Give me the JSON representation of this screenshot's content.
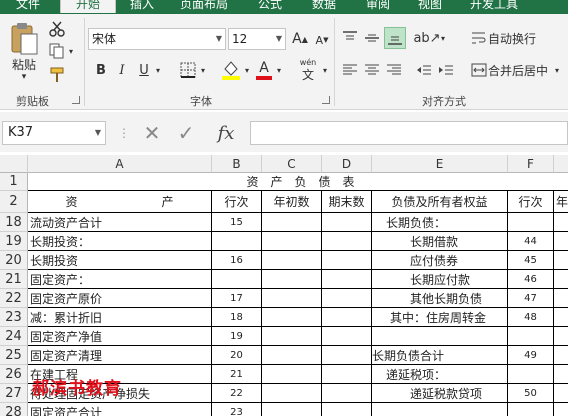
{
  "tabs": [
    "文件",
    "开始",
    "插入",
    "页面布局",
    "公式",
    "数据",
    "审阅",
    "视图",
    "开发工具"
  ],
  "clipboard": {
    "paste": "粘贴",
    "group": "剪贴板"
  },
  "font": {
    "name": "宋体",
    "size": "12",
    "bold": "B",
    "italic": "I",
    "underline": "U",
    "group": "字体",
    "phonetic": "wén"
  },
  "alignment": {
    "wrap": "自动换行",
    "merge": "合并后居中",
    "group": "对齐方式"
  },
  "formula_bar": {
    "name_box": "K37",
    "fx": "fx",
    "value": ""
  },
  "columns": [
    "A",
    "B",
    "C",
    "D",
    "E",
    "F"
  ],
  "sheet": {
    "title": "资　产　负　债　表",
    "header": {
      "asset": "资　　　　　　　产",
      "row_no": "行次",
      "begin": "年初数",
      "end": "期末数",
      "liab": "负债及所有者权益",
      "row_no2": "行次",
      "partial": "年"
    },
    "rows": [
      {
        "n": "18",
        "a": "流动资产合计",
        "b": "15",
        "e": "长期负债：",
        "f": ""
      },
      {
        "n": "19",
        "a": "长期投资：",
        "b": "",
        "e": "长期借款",
        "f": "44"
      },
      {
        "n": "20",
        "a": "长期投资",
        "b": "16",
        "e": "应付债券",
        "f": "45"
      },
      {
        "n": "21",
        "a": "固定资产：",
        "b": "",
        "e": "长期应付款",
        "f": "46"
      },
      {
        "n": "22",
        "a": "固定资产原价",
        "b": "17",
        "e": "其他长期负债",
        "f": "47"
      },
      {
        "n": "23",
        "a": "减：累计折旧",
        "b": "18",
        "e": "其中：住房周转金",
        "f": "48"
      },
      {
        "n": "24",
        "a": "固定资产净值",
        "b": "19",
        "e": "",
        "f": ""
      },
      {
        "n": "25",
        "a": "固定资产清理",
        "b": "20",
        "e": "长期负债合计",
        "f": "49"
      },
      {
        "n": "26",
        "a": "在建工程",
        "b": "21",
        "e": "递延税项：",
        "f": ""
      },
      {
        "n": "27",
        "a": "待处理固定资产净损失",
        "b": "22",
        "e": "递延税款贷项",
        "f": "50"
      },
      {
        "n": "28",
        "a": "固定资产合计",
        "b": "23",
        "e": "",
        "f": ""
      }
    ]
  },
  "watermark": "郝滨书教育",
  "colors": {
    "accent": "#217346",
    "red_font": "#e0101a",
    "highlight": "#ffff00"
  }
}
